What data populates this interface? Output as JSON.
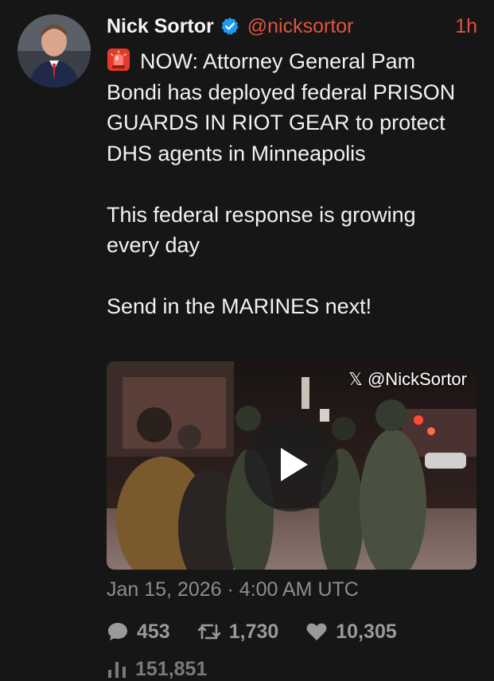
{
  "author": {
    "name": "Nick Sortor",
    "handle": "@nicksortor",
    "time_ago": "1h",
    "verified_icon": "verified-badge-icon",
    "avatar": "profile-photo"
  },
  "tweet": {
    "emoji": "siren-icon",
    "lines": [
      "NOW: Attorney General Pam Bondi has deployed federal PRISON GUARDS IN RIOT GEAR to protect DHS agents in Minneapolis",
      "This federal response is growing every day",
      "Send in the MARINES next!"
    ]
  },
  "media": {
    "type": "video",
    "watermark": "𝕏 @NickSortor",
    "play_icon": "play-icon"
  },
  "timestamp": "Jan 15, 2026 · 4:00 AM UTC",
  "stats": {
    "replies": "453",
    "retweets": "1,730",
    "likes": "10,305",
    "views": "151,851"
  },
  "colors": {
    "background": "#161616",
    "accent": "#e1533f",
    "verified": "#1d9bf0",
    "muted": "#8d8d8d"
  }
}
